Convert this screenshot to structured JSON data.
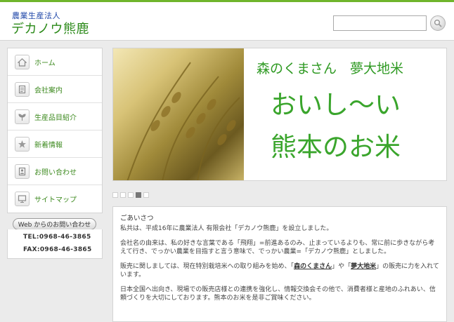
{
  "header": {
    "logo_sub": "農業生産法人",
    "logo_main": "デカノウ熊鹿",
    "search_placeholder": ""
  },
  "nav": {
    "items": [
      {
        "label": "ホーム",
        "icon": "home-icon"
      },
      {
        "label": "会社案内",
        "icon": "document-icon"
      },
      {
        "label": "生産品目紹介",
        "icon": "sprout-icon"
      },
      {
        "label": "新着情報",
        "icon": "star-icon"
      },
      {
        "label": "お問い合わせ",
        "icon": "contact-icon"
      },
      {
        "label": "サイトマップ",
        "icon": "sitemap-icon"
      }
    ]
  },
  "sidebar": {
    "web_inquiry": "Web からのお問い合わせ",
    "tel": "TEL:0968-46-3865",
    "fax": "FAX:0968-46-3865"
  },
  "hero": {
    "small_text": "森のくまさん　夢大地米",
    "big_line1": "おいし～い",
    "big_line2": "熊本のお米"
  },
  "slider": {
    "count": 5,
    "active_index": 3
  },
  "content": {
    "title": "ごあいさつ",
    "p1": "私共は、平成16年に農業法人 有限会社「デカノウ熊鹿」を設立しました。",
    "p2": "会社名の由来は、私の好きな言葉である「飛翔」=前進あるのみ、止まっているよりも、常に前に歩きながら考えて行き、でっかい農業を目指すと言う意味で、でっかい農業=「デカノウ熊鹿」としました。",
    "p3_a": "販売に関しましては、現在特別栽培米への取り組みを始め、「",
    "p3_em1": "森のくまさん",
    "p3_b": "」や「",
    "p3_em2": "夢大地米",
    "p3_c": "」の販売に力を入れています。",
    "p4": "日本全国へ出向き、現場での販売店様との連携を強化し、情報交換会その他で、消費者様と産地のふれあい、信頼づくりを大切にしております。熊本のお米を是非ご賞味ください。"
  },
  "colors": {
    "accent_green": "#3aa52c",
    "logo_blue": "#1f47a8"
  }
}
